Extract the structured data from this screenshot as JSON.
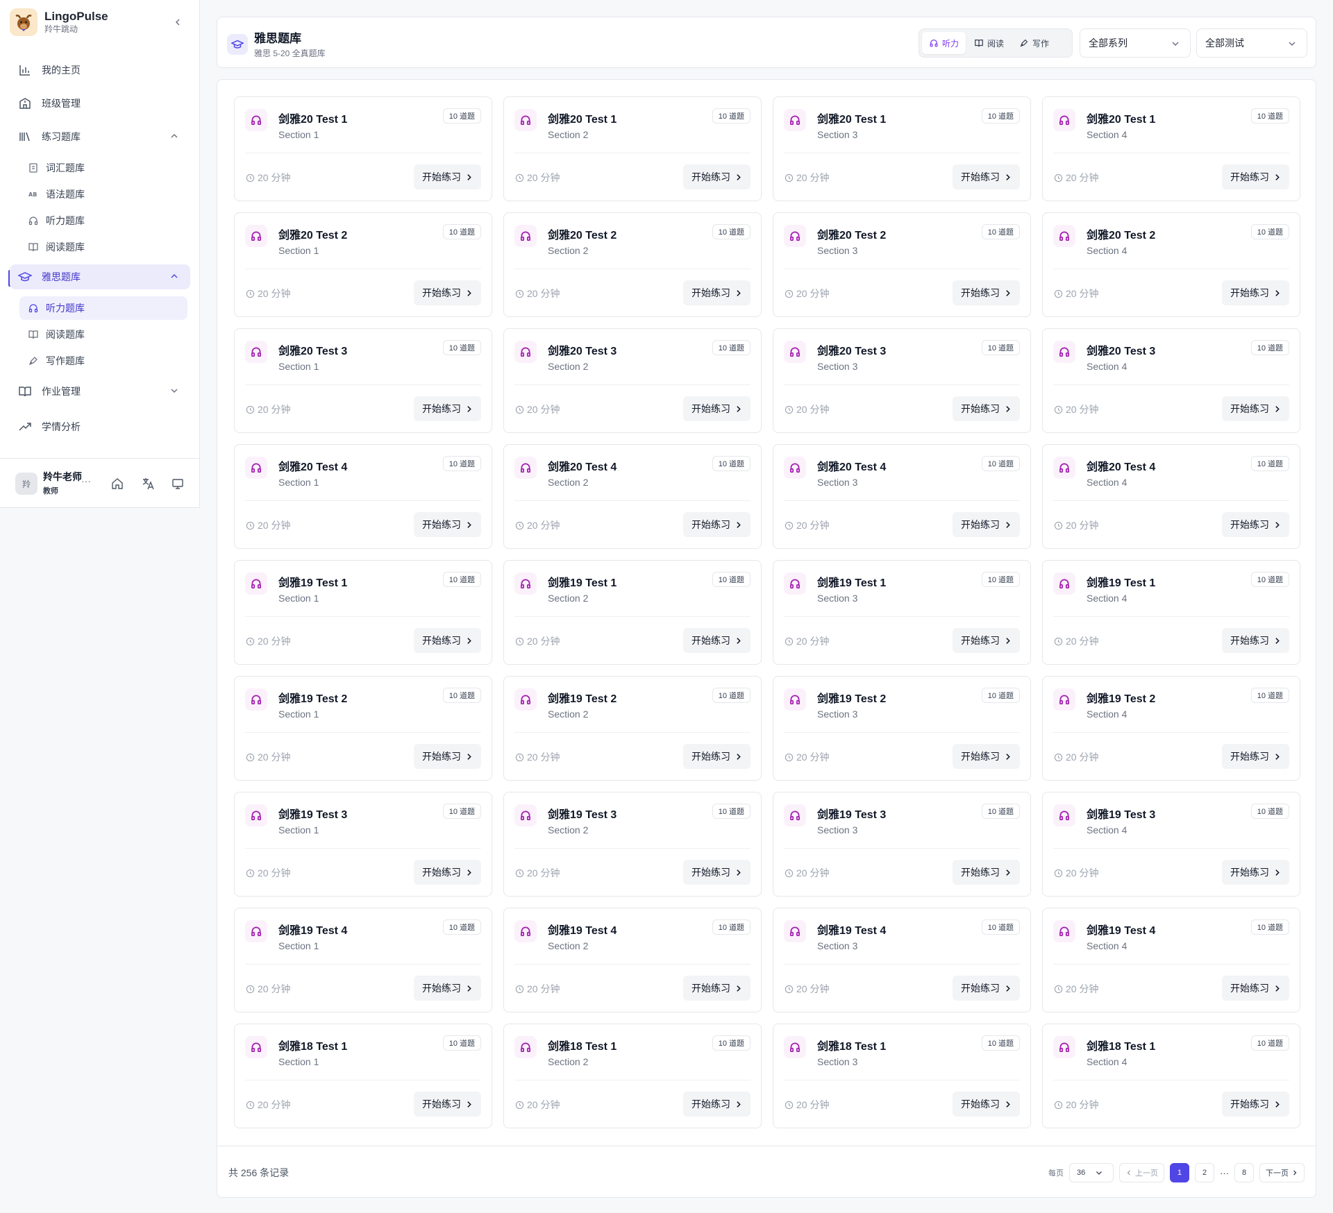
{
  "brand": {
    "name": "LingoPulse",
    "subtitle": "羚牛跳动"
  },
  "nav": {
    "home": "我的主页",
    "classes": "班级管理",
    "practice": "练习题库",
    "practice_items": [
      "词汇题库",
      "语法题库",
      "听力题库",
      "阅读题库"
    ],
    "ielts": "雅思题库",
    "ielts_items": [
      "听力题库",
      "阅读题库",
      "写作题库"
    ],
    "homework": "作业管理",
    "analytics": "学情分析"
  },
  "user": {
    "avatar": "羚",
    "name": "羚牛老师",
    "role": "教师",
    "more": "···"
  },
  "header": {
    "title": "雅思题库",
    "subtitle": "雅思 5-20 全真题库",
    "tabs": [
      "听力",
      "阅读",
      "写作"
    ],
    "active_tab": "听力",
    "series_select": "全部系列",
    "test_select": "全部测试"
  },
  "card_common": {
    "badge": "10 道题",
    "time": "20 分钟",
    "button": "开始练习"
  },
  "cards": [
    {
      "title": "剑雅20 Test 1",
      "section": "Section 1"
    },
    {
      "title": "剑雅20 Test 1",
      "section": "Section 2"
    },
    {
      "title": "剑雅20 Test 1",
      "section": "Section 3"
    },
    {
      "title": "剑雅20 Test 1",
      "section": "Section 4"
    },
    {
      "title": "剑雅20 Test 2",
      "section": "Section 1"
    },
    {
      "title": "剑雅20 Test 2",
      "section": "Section 2"
    },
    {
      "title": "剑雅20 Test 2",
      "section": "Section 3"
    },
    {
      "title": "剑雅20 Test 2",
      "section": "Section 4"
    },
    {
      "title": "剑雅20 Test 3",
      "section": "Section 1"
    },
    {
      "title": "剑雅20 Test 3",
      "section": "Section 2"
    },
    {
      "title": "剑雅20 Test 3",
      "section": "Section 3"
    },
    {
      "title": "剑雅20 Test 3",
      "section": "Section 4"
    },
    {
      "title": "剑雅20 Test 4",
      "section": "Section 1"
    },
    {
      "title": "剑雅20 Test 4",
      "section": "Section 2"
    },
    {
      "title": "剑雅20 Test 4",
      "section": "Section 3"
    },
    {
      "title": "剑雅20 Test 4",
      "section": "Section 4"
    },
    {
      "title": "剑雅19 Test 1",
      "section": "Section 1"
    },
    {
      "title": "剑雅19 Test 1",
      "section": "Section 2"
    },
    {
      "title": "剑雅19 Test 1",
      "section": "Section 3"
    },
    {
      "title": "剑雅19 Test 1",
      "section": "Section 4"
    },
    {
      "title": "剑雅19 Test 2",
      "section": "Section 1"
    },
    {
      "title": "剑雅19 Test 2",
      "section": "Section 2"
    },
    {
      "title": "剑雅19 Test 2",
      "section": "Section 3"
    },
    {
      "title": "剑雅19 Test 2",
      "section": "Section 4"
    },
    {
      "title": "剑雅19 Test 3",
      "section": "Section 1"
    },
    {
      "title": "剑雅19 Test 3",
      "section": "Section 2"
    },
    {
      "title": "剑雅19 Test 3",
      "section": "Section 3"
    },
    {
      "title": "剑雅19 Test 3",
      "section": "Section 4"
    },
    {
      "title": "剑雅19 Test 4",
      "section": "Section 1"
    },
    {
      "title": "剑雅19 Test 4",
      "section": "Section 2"
    },
    {
      "title": "剑雅19 Test 4",
      "section": "Section 3"
    },
    {
      "title": "剑雅19 Test 4",
      "section": "Section 4"
    },
    {
      "title": "剑雅18 Test 1",
      "section": "Section 1"
    },
    {
      "title": "剑雅18 Test 1",
      "section": "Section 2"
    },
    {
      "title": "剑雅18 Test 1",
      "section": "Section 3"
    },
    {
      "title": "剑雅18 Test 1",
      "section": "Section 4"
    }
  ],
  "pagination": {
    "total": "共 256 条记录",
    "per_page_label": "每页",
    "per_page": "36",
    "prev": "上一页",
    "pages": [
      "1",
      "2"
    ],
    "ellipsis": "···",
    "last_page": "8",
    "next": "下一页"
  },
  "colors": {
    "accent": "#4f46e5",
    "listening": "#a21caf",
    "active_tab": "#7c3aed"
  }
}
